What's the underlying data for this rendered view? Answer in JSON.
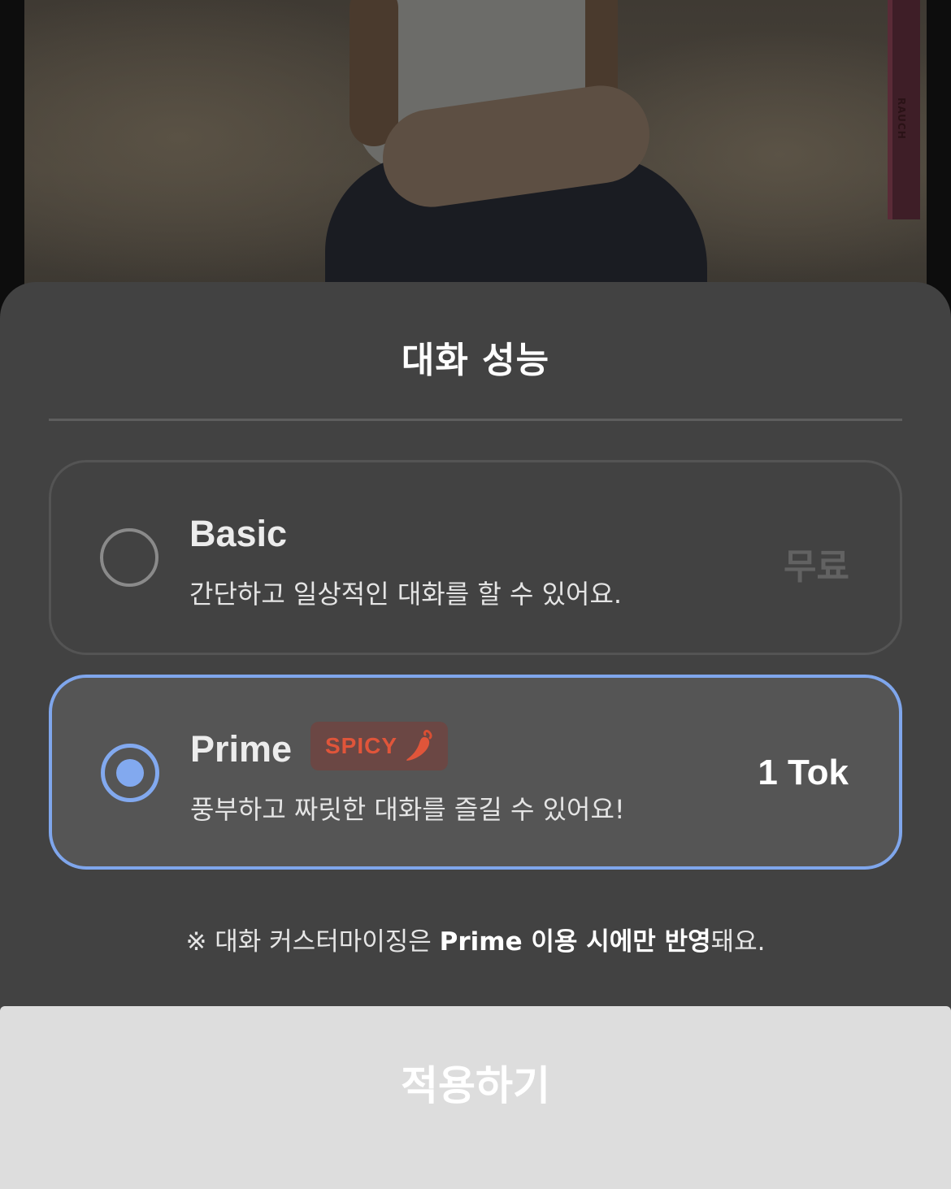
{
  "sheet": {
    "title": "대화 성능"
  },
  "options": [
    {
      "name": "Basic",
      "description": "간단하고 일상적인 대화를 할 수 있어요.",
      "price": "무료",
      "selected": false
    },
    {
      "name": "Prime",
      "badge": "SPICY",
      "badge_icon": "chili-pepper-icon",
      "description": "풍부하고 짜릿한 대화를 즐길 수 있어요!",
      "price": "1 Tok",
      "selected": true
    }
  ],
  "notice": {
    "prefix": "※ 대화 커스터마이징은 ",
    "bold": "Prime 이용 시에만 반영",
    "suffix": "돼요."
  },
  "apply_button": {
    "label": "적용하기"
  },
  "colors": {
    "sheet_bg": "#424242",
    "accent_blue": "#82a9ef",
    "spicy_red": "#e0553a",
    "button_bg": "#dddddd"
  }
}
